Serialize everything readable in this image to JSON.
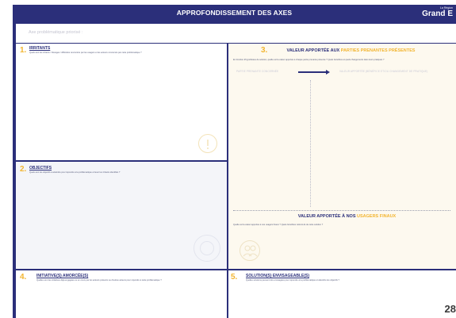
{
  "header": {
    "title": "APPROFONDISSEMENT DES AXES",
    "logo_small": "La Région",
    "logo_big": "Grand E"
  },
  "problem": {
    "placeholder": "Axe problématique priorisé :"
  },
  "irritants": {
    "number": "1.",
    "title": "IRRITANTS",
    "description": "Quels sont les irritants / blocages / difficultés rencontrés par les usagers et les acteurs concernés par cette problématique ?"
  },
  "objectifs": {
    "number": "2.",
    "title": "OBJECTIFS",
    "description": "Quels sont les objectifs à atteindre pour répondre à la problématique et lever les irritants identifiés ?"
  },
  "valeur": {
    "number": "3.",
    "title_prefix": "VALEUR APPORTÉE AUX ",
    "title_highlight": "PARTIES PRENANTES PRÉSENTES",
    "description": "En fonction d'hypothèses de solution, quelle est la valeur apportée à chaque partie prenante présente ? Quels bénéfices et quels changements dans leurs pratiques ?",
    "label_left": "PARTIE PRENANTE CONCERNÉE",
    "label_right": "VALEUR APPORTÉE (BÉNÉFICE ET/OU CHANGEMENT DE PRATIQUE)",
    "usagers_prefix": "VALEUR APPORTÉE À NOS ",
    "usagers_highlight": "USAGERS FINAUX",
    "usagers_description": "Quelle est la valeur apportée à nos usagers finaux ? Quels bénéfices retirent-ils de cette solution ?"
  },
  "initiatives": {
    "number": "4.",
    "title": "INITIATIVE(S) AMORCÉE(S)",
    "description": "Quelles sont les initiatives déjà engagées ou en cours par les acteurs présents ou d'autres acteurs pour répondre à cette problématique ?"
  },
  "solutions": {
    "number": "5.",
    "title": "SOLUTION(S) ENVISAGEABLE(S)",
    "description": "Quelles solutions peuvent être envisagées pour répondre à la problématique et atteindre les objectifs ?"
  },
  "footer": {
    "page_number": "28"
  },
  "colors": {
    "navy": "#2b2f7a",
    "accent": "#f2b531",
    "cream": "#fdf9ef"
  }
}
